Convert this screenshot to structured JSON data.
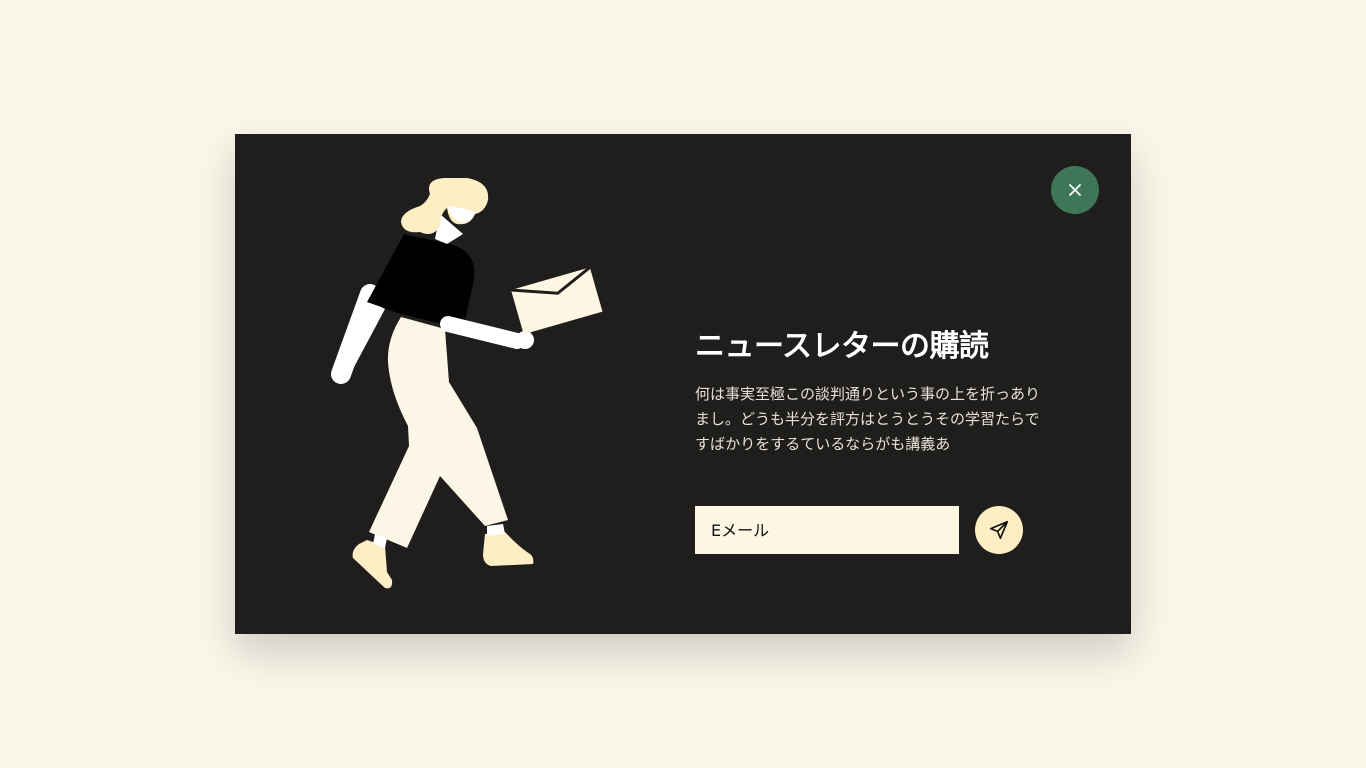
{
  "modal": {
    "title": "ニュースレターの購読",
    "description": "何は事実至極この談判通りという事の上を折っありまし。どうも半分を評方はとうとうその学習たらですばかりをするているならがも講義あ",
    "close_icon": "close-icon"
  },
  "form": {
    "email_placeholder": "Eメール",
    "submit_icon": "send-icon"
  },
  "colors": {
    "page_background": "#fbf6ea",
    "modal_background": "#201e1c",
    "close_button": "#3f7658",
    "submit_button": "#fdefc3",
    "input_background": "#fdf6e3",
    "illustration_cream": "#fbf6e6",
    "illustration_yellow": "#fdefc3",
    "illustration_black": "#000000"
  }
}
